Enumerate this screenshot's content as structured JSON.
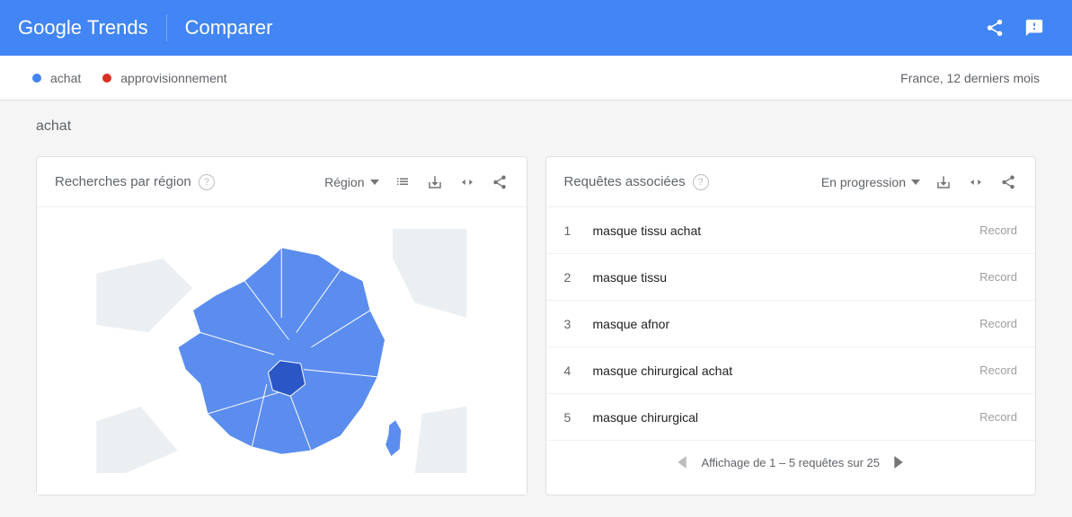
{
  "header": {
    "logo_prefix": "Google",
    "logo_suffix": "Trends",
    "title": "Comparer"
  },
  "compare": {
    "terms": [
      {
        "label": "achat",
        "color": "#4285f4"
      },
      {
        "label": "approvisionnement",
        "color": "#d93025"
      }
    ],
    "meta": "France, 12 derniers mois"
  },
  "section": {
    "title": "achat"
  },
  "region_card": {
    "title": "Recherches par région",
    "dropdown": "Région"
  },
  "queries_card": {
    "title": "Requêtes associées",
    "dropdown": "En progression",
    "rows": [
      {
        "rank": "1",
        "text": "masque tissu achat",
        "value": "Record"
      },
      {
        "rank": "2",
        "text": "masque tissu",
        "value": "Record"
      },
      {
        "rank": "3",
        "text": "masque afnor",
        "value": "Record"
      },
      {
        "rank": "4",
        "text": "masque chirurgical achat",
        "value": "Record"
      },
      {
        "rank": "5",
        "text": "masque chirurgical",
        "value": "Record"
      }
    ],
    "pagination": "Affichage de 1 – 5 requêtes sur 25"
  }
}
